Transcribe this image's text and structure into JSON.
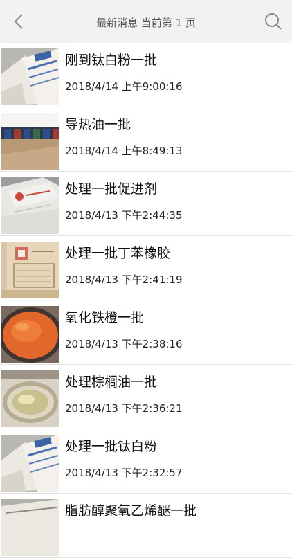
{
  "header": {
    "title": "最新消息 当前第 1 页",
    "back_icon": "chevron-left-icon",
    "search_icon": "search-icon"
  },
  "news": [
    {
      "title": "刚到钛白粉一批",
      "time": "2018/4/14 上午9:00:16",
      "thumb": "white-sacks"
    },
    {
      "title": "导热油一批",
      "time": "2018/4/14 上午8:49:13",
      "thumb": "drums-warehouse"
    },
    {
      "title": "处理一批促进剂",
      "time": "2018/4/13 下午2:44:35",
      "thumb": "bags-with-red-label"
    },
    {
      "title": "处理一批丁苯橡胶",
      "time": "2018/4/13 下午2:41:19",
      "thumb": "cardboard-box"
    },
    {
      "title": "氧化铁橙一批",
      "time": "2018/4/13 下午2:38:16",
      "thumb": "orange-pigment-bucket"
    },
    {
      "title": "处理棕榈油一批",
      "time": "2018/4/13 下午2:36:21",
      "thumb": "oil-tin"
    },
    {
      "title": "处理一批钛白粉",
      "time": "2018/4/13 下午2:32:57",
      "thumb": "white-sacks"
    },
    {
      "title": "脂肪醇聚氧乙烯醚一批",
      "time": "",
      "thumb": "white-sacks"
    }
  ],
  "colors": {
    "header_bg": "#f2f2f2",
    "title_text": "#555555",
    "divider": "#e3e3e3"
  }
}
